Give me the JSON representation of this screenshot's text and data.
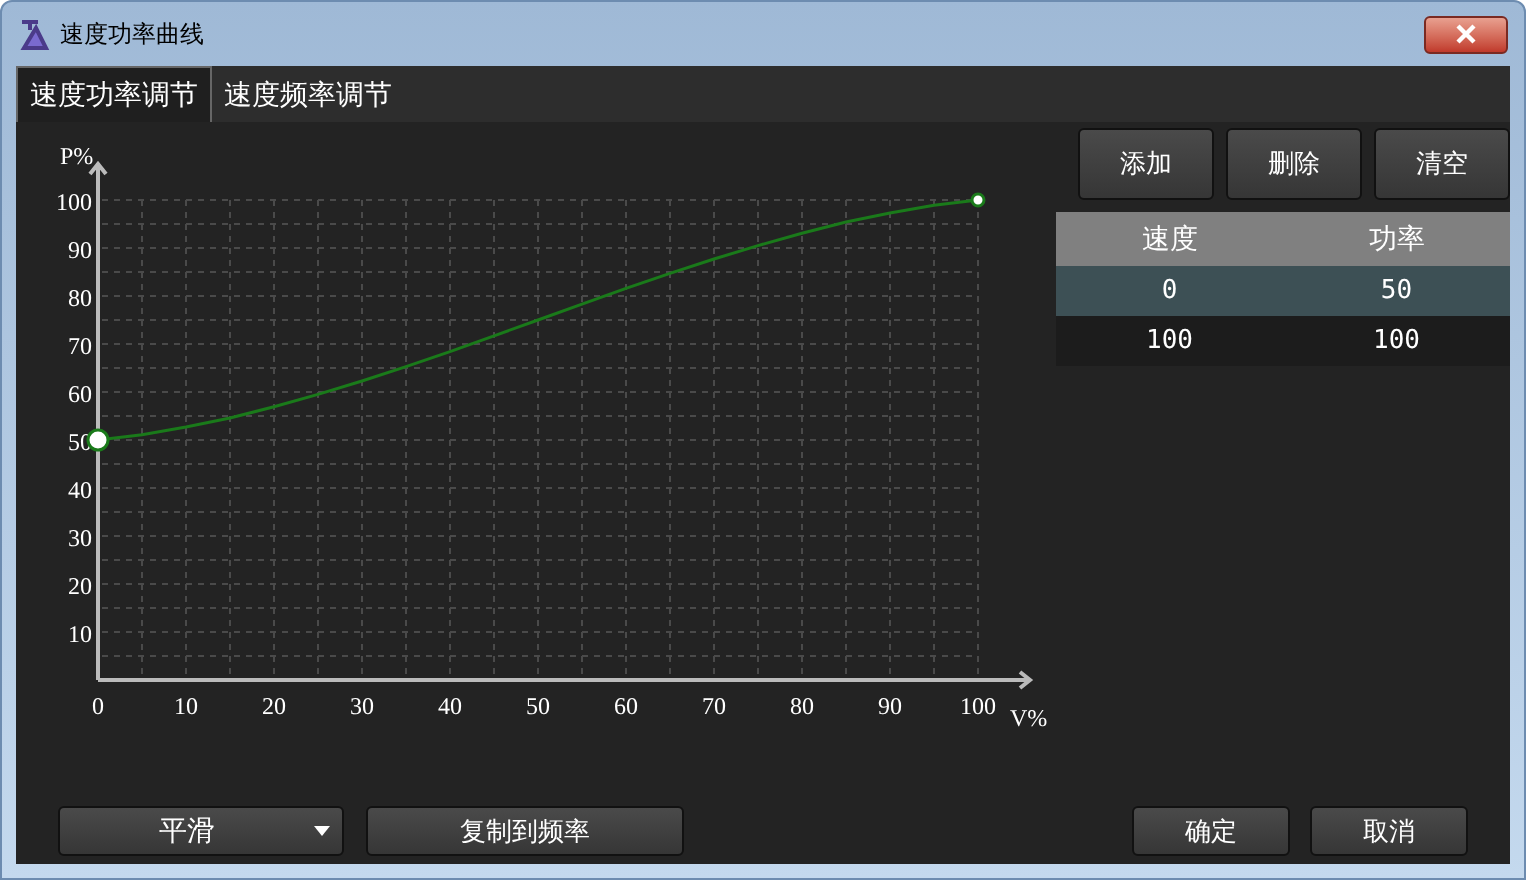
{
  "window": {
    "title": "速度功率曲线"
  },
  "tabs": [
    {
      "label": "速度功率调节",
      "selected": true
    },
    {
      "label": "速度频率调节",
      "selected": false
    }
  ],
  "chart": {
    "chart_data": {
      "type": "line",
      "grid": true,
      "xlabel": "V%",
      "ylabel": "P%",
      "x": [
        0,
        5,
        10,
        15,
        20,
        25,
        30,
        35,
        40,
        45,
        50,
        55,
        60,
        65,
        70,
        75,
        80,
        85,
        90,
        95,
        100
      ],
      "series": [
        {
          "color": "#1a7a1a",
          "values": [
            50,
            51.1,
            52.7,
            54.6,
            56.9,
            59.5,
            62.3,
            65.3,
            68.4,
            71.7,
            75,
            78.3,
            81.6,
            84.7,
            87.7,
            90.5,
            93.1,
            95.4,
            97.3,
            98.9,
            100
          ]
        }
      ],
      "xlim": [
        0,
        100
      ],
      "ylim": [
        0,
        100
      ],
      "xticks": [
        0,
        10,
        20,
        30,
        40,
        50,
        60,
        70,
        80,
        90,
        100
      ],
      "yticks": [
        10,
        20,
        30,
        40,
        50,
        60,
        70,
        80,
        90,
        100
      ]
    }
  },
  "toolbar": [
    "添加",
    "删除",
    "清空"
  ],
  "table": {
    "columns": [
      "速度",
      "功率"
    ],
    "rows": [
      {
        "cells": [
          "0",
          "50"
        ],
        "selected": true
      },
      {
        "cells": [
          "100",
          "100"
        ],
        "selected": false
      }
    ]
  },
  "mode_dropdown": {
    "value": "平滑"
  },
  "copy_button": "复制到频率",
  "buttons": [
    "确定",
    "取消"
  ]
}
